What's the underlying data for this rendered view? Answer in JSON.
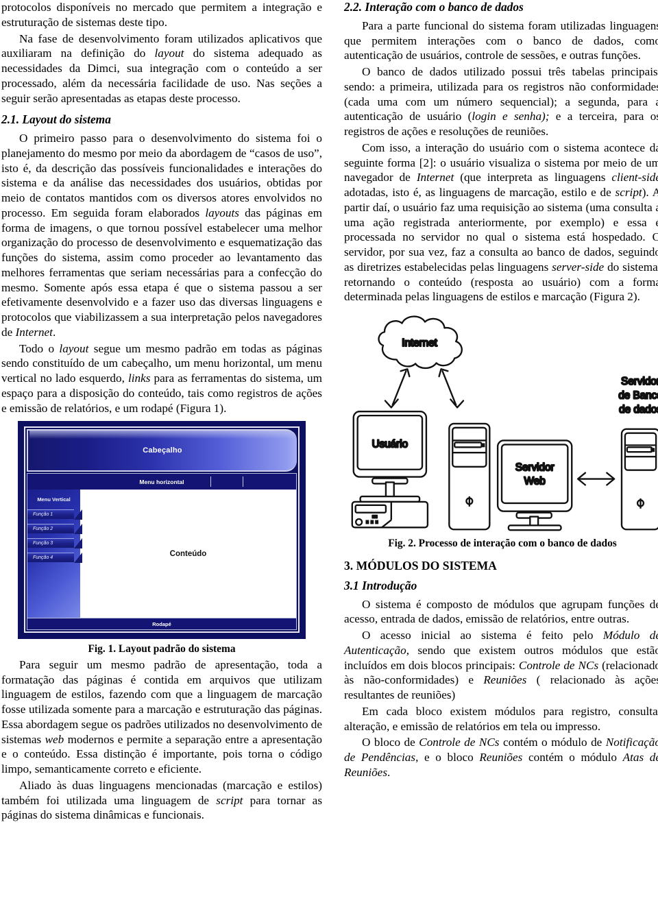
{
  "document": {
    "left_column": {
      "continued_paragraph": "protocolos disponíveis no mercado que permitem a integração e estruturação de sistemas deste tipo.",
      "paragraph_2": "Na fase de desenvolvimento foram utilizados aplicativos que auxiliaram na definição do layout do sistema adequado as necessidades da Dimci, sua integração com o conteúdo a ser processado, além da necessária facilidade de uso. Nas seções a seguir serão apresentadas as etapas deste processo.",
      "section_2_1_heading": "2.1. Layout do sistema",
      "paragraph_3": "O primeiro passo para o desenvolvimento do sistema foi o planejamento do mesmo por meio da abordagem de “casos de uso”, isto é, da descrição das possíveis funcionalidades e interações do sistema e da análise das necessidades dos usuários, obtidas por meio de contatos mantidos com os diversos atores envolvidos no processo. Em seguida foram elaborados layouts das páginas em forma de imagens, o que tornou possível estabelecer uma melhor organização do processo de desenvolvimento e esquematização das funções do sistema, assim como proceder ao levantamento das melhores ferramentas que seriam necessárias para a confecção do mesmo. Somente após essa etapa é que o sistema passou a ser efetivamente desenvolvido e a fazer uso das diversas linguagens e protocolos que viabilizassem a sua interpretação pelos navegadores de Internet.",
      "paragraph_4": "Todo o layout segue um mesmo padrão em todas as páginas sendo constituído de um cabeçalho, um menu horizontal, um menu vertical no lado esquerdo, links para as ferramentas do sistema, um espaço para a disposição do conteúdo, tais como registros de ações e emissão de relatórios, e um rodapé (Figura 1).",
      "figure_1_caption": "Fig. 1. Layout padrão do sistema",
      "paragraph_5": "Para seguir um mesmo padrão de apresentação, toda a formatação das páginas é contida em arquivos que utilizam linguagem de estilos, fazendo com que a linguagem de marcação fosse utilizada somente para a marcação e estruturação das páginas. Essa abordagem segue os padrões utilizados no desenvolvimento de sistemas web modernos e permite a separação entre a apresentação e o conteúdo. Essa distinção é importante, pois torna o código limpo, semanticamente correto e eficiente.",
      "paragraph_6": "Aliado às duas linguagens mencionadas (marcação e estilos) também foi utilizada uma linguagem de script para tornar as páginas do sistema dinâmicas e funcionais."
    },
    "right_column": {
      "section_2_2_heading": "2.2. Interação com o banco de dados",
      "paragraph_1": "Para a parte funcional do sistema foram utilizadas linguagens que permitem interações com o banco de dados, como autenticação de usuários, controle de sessões, e outras funções.",
      "paragraph_2": "O banco de dados utilizado possui três tabelas principais, sendo: a primeira, utilizada para os registros não conformidades (cada uma com um número sequencial); a segunda, para a autenticação de usuário (login e senha); e a terceira, para os registros de ações e resoluções de reuniões.",
      "paragraph_3": "Com isso, a interação do usuário com o sistema acontece da seguinte forma [2]: o usuário visualiza o sistema por meio de um navegador de Internet (que interpreta as linguagens client-side adotadas, isto é, as linguagens de marcação, estilo e de script). A partir daí, o usuário faz uma requisição ao sistema (uma consulta a uma ação registrada anteriormente, por exemplo) e essa é processada no servidor no qual o sistema está hospedado. O servidor, por sua vez, faz a consulta ao banco de dados, seguindo as diretrizes estabelecidas pelas linguagens server-side do sistema, retornando o conteúdo (resposta ao usuário) com a forma determinada pelas linguagens de estilos e marcação (Figura 2).",
      "figure_2_caption": "Fig. 2. Processo de interação com o banco de dados",
      "section_3_heading": "3. MÓDULOS DO SISTEMA",
      "section_3_1_heading": "3.1 Introdução",
      "paragraph_4": "O sistema é composto de módulos que agrupam funções de acesso, entrada de dados, emissão de relatórios, entre outras.",
      "paragraph_5": "O acesso inicial ao sistema é feito pelo Módulo de Autenticação, sendo que existem outros módulos que estão incluídos em dois blocos principais: Controle de NCs (relacionado às não-conformidades) e Reuniões ( relacionado às ações resultantes de reuniões)",
      "paragraph_6": "Em cada bloco existem módulos para registro, consulta, alteração, e emissão de relatórios em tela ou impresso.",
      "paragraph_7": "O bloco de Controle de NCs contém o módulo de Notificação de Pendências, e o bloco Reuniões contém o módulo Atas de Reuniões."
    }
  },
  "figure_1": {
    "header_label": "Cabeçalho",
    "horizontal_menu_label": "Menu horizontal",
    "vertical_menu_title": "Menu Vertical",
    "vertical_menu_items": [
      "Função 1",
      "Função 2",
      "Função 3",
      "Função 4"
    ],
    "content_label": "Conteúdo",
    "footer_label": "Rodapé",
    "colors": {
      "frame": "#0d1060",
      "header_gradient_start": "#16186e",
      "header_gradient_end": "#a6aef3",
      "menu_bar": "#131474",
      "content_background": "#ffffff",
      "border": "#e9e9f5"
    }
  },
  "figure_2": {
    "cloud_label": "Internet",
    "user_label": "Usuário",
    "web_server_label_line1": "Servidor",
    "web_server_label_line2": "Web",
    "db_server_label_line1": "Servidor",
    "db_server_label_line2": "de Banco",
    "db_server_label_line3": "de dados",
    "colors": {
      "stroke": "#111111",
      "fill": "#ffffff"
    }
  }
}
